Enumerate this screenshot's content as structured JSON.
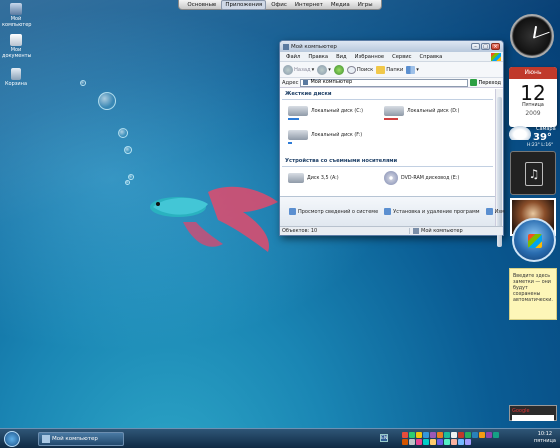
{
  "launcher": {
    "tabs": [
      "Основные",
      "Приложения",
      "Офис",
      "Интернет",
      "Медиа",
      "Игры"
    ],
    "active_index": 1
  },
  "desktop": {
    "icons": [
      {
        "label": "Мой компьютер",
        "icon": "computer-icon"
      },
      {
        "label": "Мои документы",
        "icon": "documents-icon"
      },
      {
        "label": "Корзина",
        "icon": "recycle-bin-icon"
      }
    ]
  },
  "window": {
    "title": "Мой компьютер",
    "menu": [
      "Файл",
      "Правка",
      "Вид",
      "Избранное",
      "Сервис",
      "Справка"
    ],
    "toolbar": {
      "back": "Назад",
      "search": "Поиск",
      "folders": "Папки"
    },
    "address": {
      "label": "Адрес",
      "value": "Мой компьютер",
      "go": "Переход"
    },
    "sections": [
      {
        "title": "Жесткие диски",
        "items": [
          {
            "label": "Локальный диск (C:)",
            "usage": 0.55,
            "status": "normal"
          },
          {
            "label": "Локальный диск (D:)",
            "usage": 0.7,
            "status": "warning"
          },
          {
            "label": "Локальный диск (F:)",
            "usage": 0.2,
            "status": "normal"
          }
        ]
      },
      {
        "title": "Устройства со съемными носителями",
        "items": [
          {
            "label": "Диск 3,5 (A:)"
          },
          {
            "label": "DVD-RAM дисковод (E:)"
          }
        ]
      }
    ],
    "tasks": [
      "Просмотр сведений о системе",
      "Установка и удаление программ",
      "Изм"
    ],
    "status": {
      "left": "Объектов: 10",
      "right": "Мой компьютер"
    }
  },
  "gadgets": {
    "calendar": {
      "month": "Июнь",
      "day": "12",
      "weekday": "Пятница",
      "year": "2009"
    },
    "weather": {
      "city": "Самара",
      "temp": "39°",
      "range": "H:23° L:16°"
    },
    "sticky": {
      "text": "Введите здесь заметки — они будут сохранены автоматически."
    },
    "search": {
      "label": "Google"
    }
  },
  "taskbar": {
    "active_window": "Мой компьютер",
    "lang": "EN",
    "time": "10:12",
    "day": "пятница"
  },
  "colors": {
    "accent": "#1f5f9a",
    "title": "#b8c8dc"
  }
}
